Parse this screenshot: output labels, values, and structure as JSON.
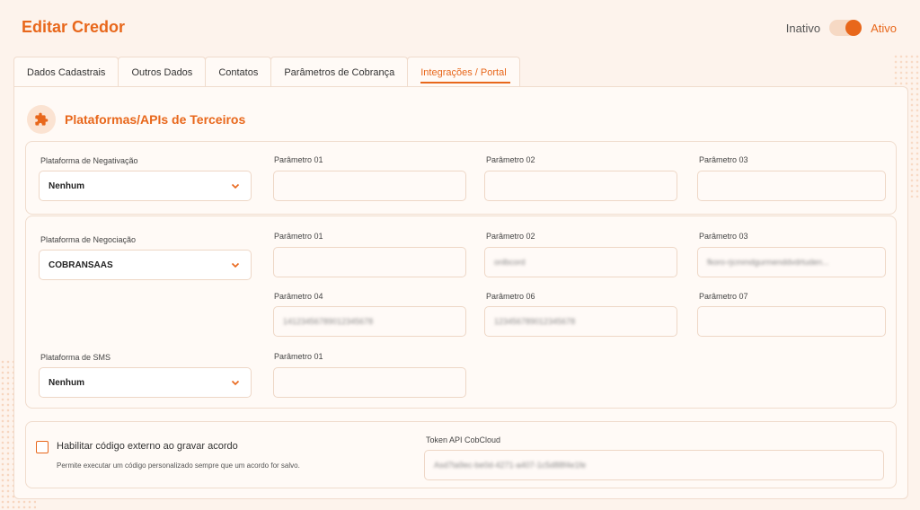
{
  "header": {
    "title": "Editar Credor",
    "status_inactive": "Inativo",
    "status_active": "Ativo",
    "toggle_on": true
  },
  "tabs": [
    {
      "label": "Dados Cadastrais"
    },
    {
      "label": "Outros Dados"
    },
    {
      "label": "Contatos"
    },
    {
      "label": "Parâmetros de Cobrança"
    },
    {
      "label": "Integrações / Portal"
    }
  ],
  "active_tab": "Integrações / Portal",
  "section": {
    "title": "Plataformas/APIs de Terceiros",
    "icon": "puzzle-icon"
  },
  "negativacao": {
    "label": "Plataforma de Negativação",
    "value": "Nenhum",
    "p1_label": "Parâmetro 01",
    "p2_label": "Parâmetro 02",
    "p3_label": "Parâmetro 03",
    "p1_value": "",
    "p2_value": "",
    "p3_value": ""
  },
  "negociacao": {
    "label": "Plataforma de Negociação",
    "value": "COBRANSAAS",
    "p1_label": "Parâmetro 01",
    "p2_label": "Parâmetro 02",
    "p3_label": "Parâmetro 03",
    "p4_label": "Parâmetro 04",
    "p6_label": "Parâmetro 06",
    "p7_label": "Parâmetro 07",
    "p1_value": "",
    "p2_value": "onlbcord",
    "p3_value": "fkoro-rjcmmdgurmenddvdrtuden...",
    "p4_value": "14123456789012345678",
    "p6_value": "123456789012345678",
    "p7_value": ""
  },
  "sms": {
    "label": "Plataforma de SMS",
    "value": "Nenhum",
    "p1_label": "Parâmetro 01",
    "p1_value": ""
  },
  "codigo_externo": {
    "checked": false,
    "label": "Habilitar código externo ao gravar acordo",
    "description": "Permite executar um código personalizado sempre que um acordo for salvo."
  },
  "token": {
    "label": "Token API CobCloud",
    "value": "Asd7ta9ec-be0d-4271-a407-1c5d88f4e1fe"
  },
  "colors": {
    "accent": "#e8671b",
    "background": "#fdf3ec",
    "border": "#f0dccd"
  }
}
